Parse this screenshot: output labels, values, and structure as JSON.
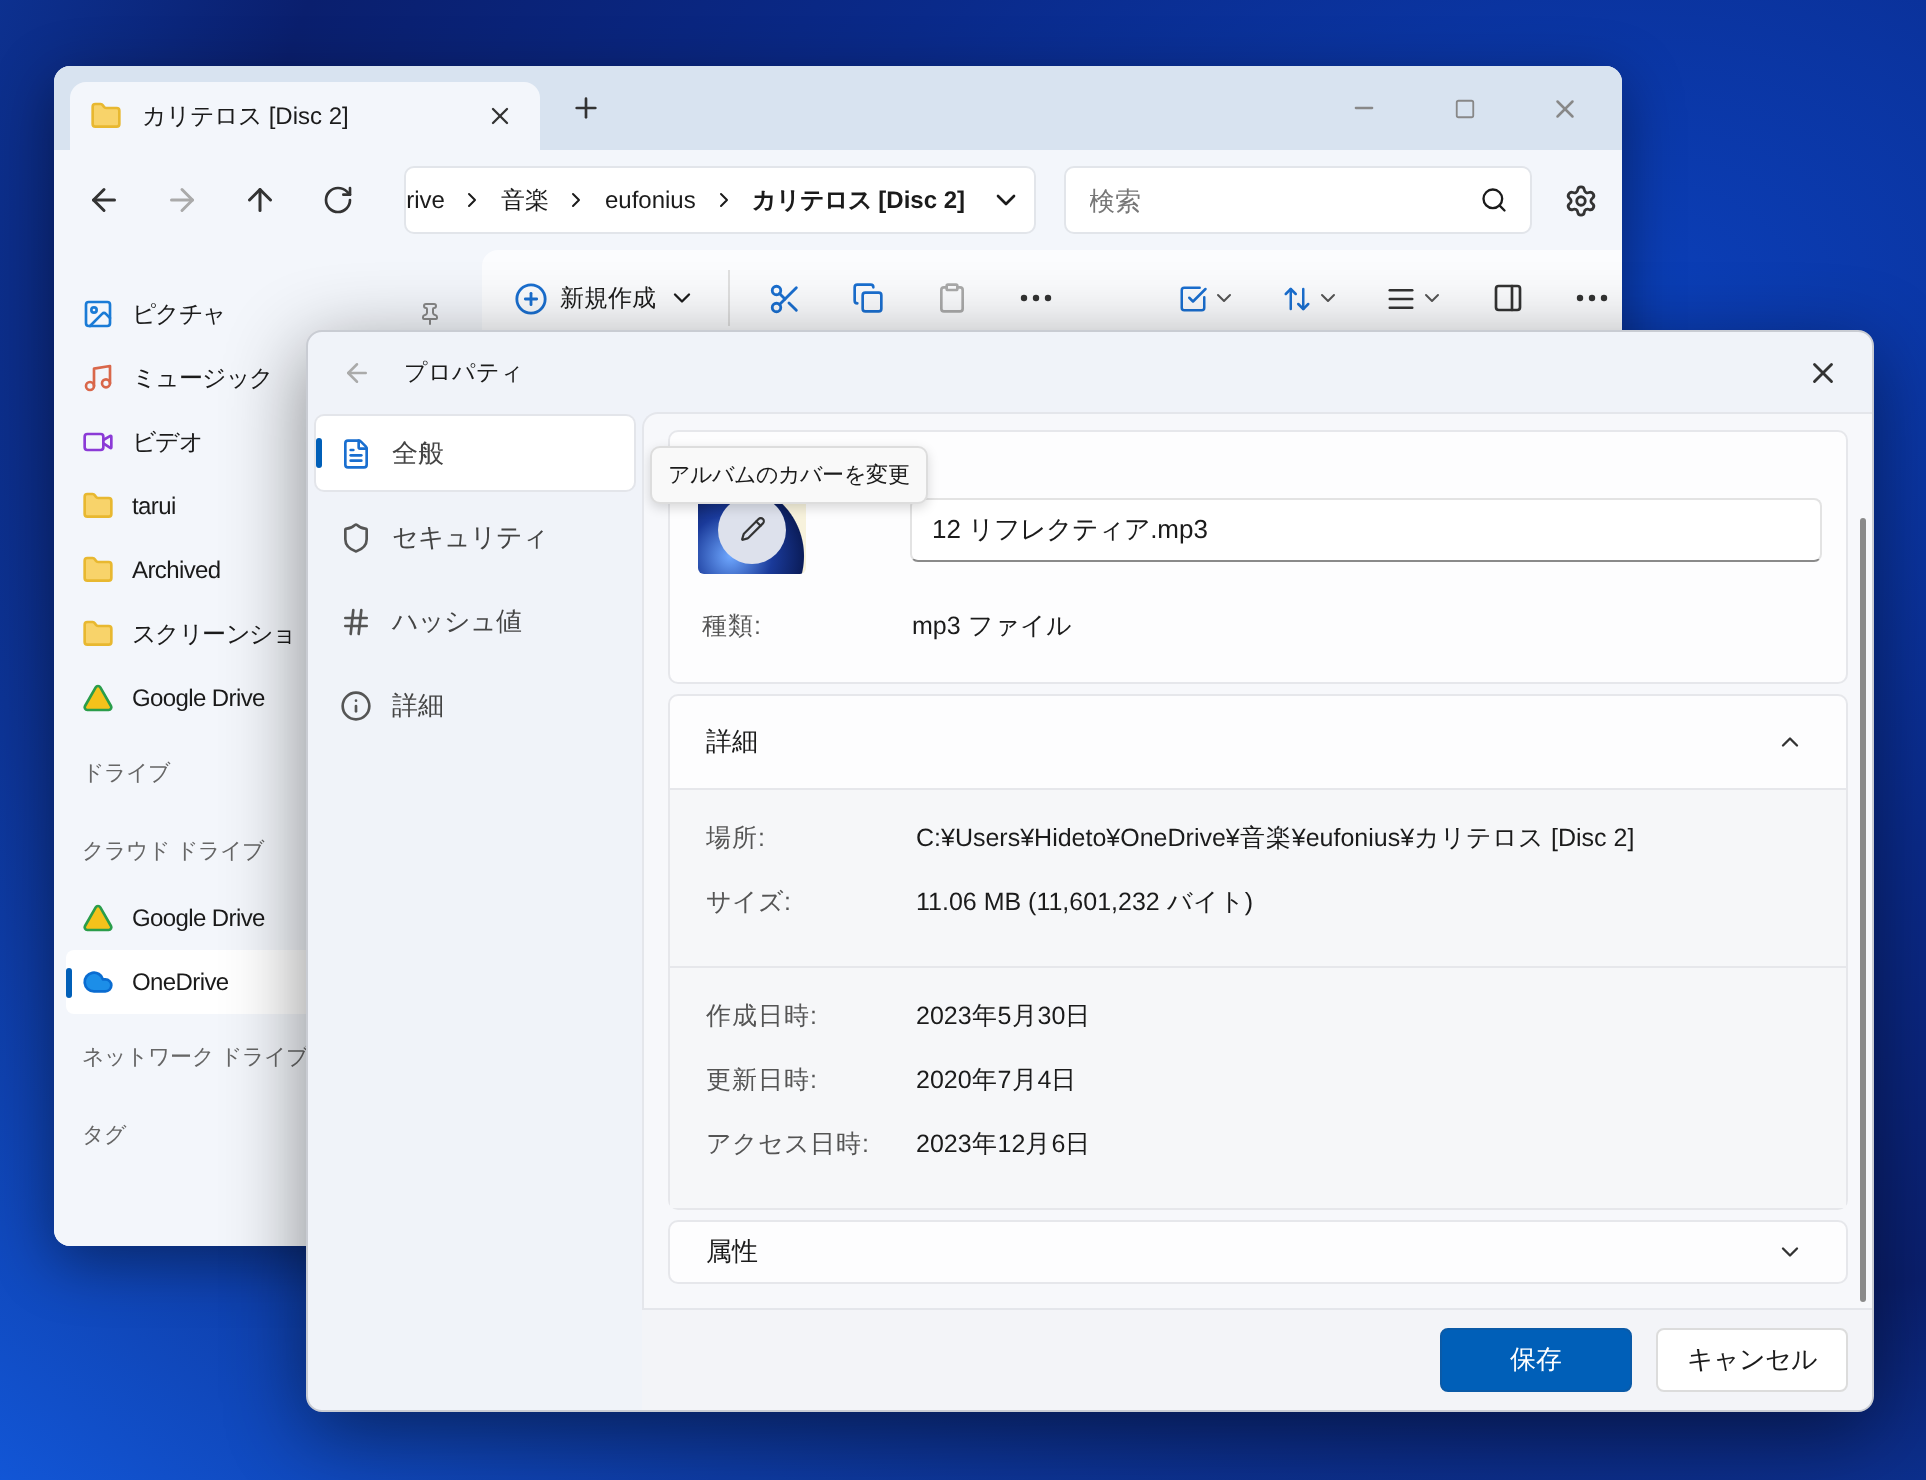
{
  "explorer": {
    "tab": {
      "title": "カリテロス [Disc 2]"
    },
    "breadcrumb": [
      "rive",
      "音楽",
      "eufonius",
      "カリテロス [Disc 2]"
    ],
    "search": {
      "placeholder": "検索"
    },
    "new_button": "新規作成",
    "sidebar": [
      {
        "kind": "pictures",
        "label": "ピクチャ",
        "pinned": true,
        "selected": false
      },
      {
        "kind": "music",
        "label": "ミュージック",
        "selected": false
      },
      {
        "kind": "video",
        "label": "ビデオ",
        "selected": false
      },
      {
        "kind": "folder",
        "label": "tarui",
        "selected": false
      },
      {
        "kind": "folder",
        "label": "Archived",
        "selected": false
      },
      {
        "kind": "folder",
        "label": "スクリーンショ",
        "selected": false
      },
      {
        "kind": "gdrive",
        "label": "Google Drive",
        "selected": false
      },
      {
        "kind": "heading",
        "label": "ドライブ"
      },
      {
        "kind": "heading",
        "label": "クラウド ドライブ"
      },
      {
        "kind": "gdrive",
        "label": "Google Drive",
        "selected": false
      },
      {
        "kind": "onedrive",
        "label": "OneDrive",
        "selected": true
      },
      {
        "kind": "heading",
        "label": "ネットワーク ドライブ"
      },
      {
        "kind": "heading",
        "label": "タグ"
      }
    ]
  },
  "dialog": {
    "title": "プロパティ",
    "nav": [
      {
        "kind": "general",
        "label": "全般",
        "selected": true
      },
      {
        "kind": "security",
        "label": "セキュリティ",
        "selected": false
      },
      {
        "kind": "hash",
        "label": "ハッシュ値",
        "selected": false
      },
      {
        "kind": "info",
        "label": "詳細",
        "selected": false
      }
    ],
    "tooltip": "アルバムのカバーを変更",
    "filename": "12 リフレクティア.mp3",
    "general_rows": [
      {
        "label": "種類:",
        "value": "mp3 ファイル"
      }
    ],
    "details": {
      "title": "詳細",
      "expanded": true,
      "groups": [
        [
          {
            "label": "場所:",
            "value": "C:¥Users¥Hideto¥OneDrive¥音楽¥eufonius¥カリテロス [Disc 2]"
          },
          {
            "label": "サイズ:",
            "value": "11.06 MB (11,601,232 バイト)"
          }
        ],
        [
          {
            "label": "作成日時:",
            "value": "2023年5月30日"
          },
          {
            "label": "更新日時:",
            "value": "2020年7月4日"
          },
          {
            "label": "アクセス日時:",
            "value": "2023年12月6日"
          }
        ]
      ]
    },
    "attributes": {
      "title": "属性",
      "expanded": false
    },
    "buttons": [
      {
        "kind": "primary",
        "label": "保存"
      },
      {
        "kind": "secondary",
        "label": "キャンセル"
      }
    ]
  }
}
